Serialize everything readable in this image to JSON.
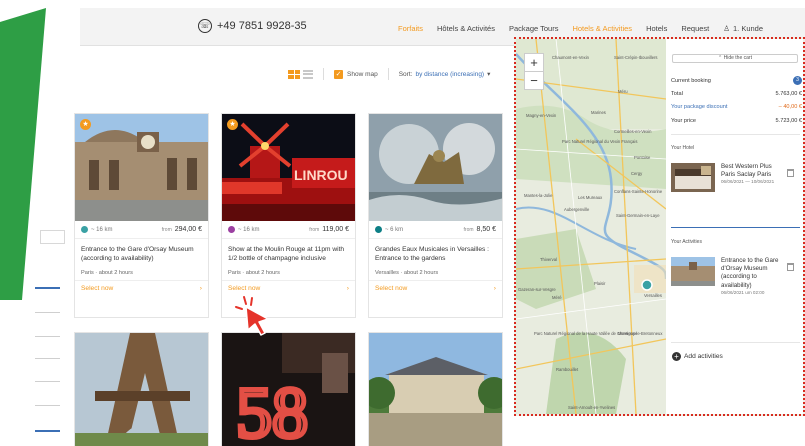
{
  "header": {
    "phone": "+49 7851 9928-35",
    "nav": [
      "Forfaits",
      "Hôtels & Activités",
      "Package Tours",
      "Hotels & Activities",
      "Hotels",
      "Request"
    ],
    "user": "1. Kunde"
  },
  "toolbar": {
    "show_map": "Show map",
    "sort_label": "Sort:",
    "sort_value": "by distance (increasing)"
  },
  "cards": [
    {
      "distance": "~ 16 km",
      "price_prefix": "from",
      "price": "294,00 €",
      "title": "Entrance to the Gare d'Orsay Museum (according to availability)",
      "location": "Paris · about 2 hours",
      "select": "Select now",
      "dot_color": "#3aa1a4"
    },
    {
      "distance": "~ 16 km",
      "price_prefix": "from",
      "price": "119,00 €",
      "title": "Show at the Moulin Rouge at 11pm with 1/2 bottle of champagne inclusive",
      "location": "Paris · about 2 hours",
      "select": "Select now",
      "dot_color": "#9b3fa1"
    },
    {
      "distance": "~ 6 km",
      "price_prefix": "from",
      "price": "8,50 €",
      "title": "Grandes Eaux Musicales in Versailles : Entrance to the gardens",
      "location": "Versailles · about 2 hours",
      "select": "Select now",
      "dot_color": "#0d7f86"
    }
  ],
  "map": {
    "zoom_in": "+",
    "zoom_out": "−",
    "labels": [
      "Chaumont-en-Vexin",
      "Saint-Crépin-Ibouvillers",
      "Méru",
      "Magny-en-Vexin",
      "Marines",
      "Parc Naturel Régional du Vexin Français",
      "Cormeilles-en-Vexin",
      "Pontoise",
      "Cergy",
      "Conflans-Sainte-Honorine",
      "Les Mureaux",
      "Mantes-la-Jolie",
      "Aubergenville",
      "Saint-Germain-en-Laye",
      "Thiverval",
      "Plaisir",
      "Versailles",
      "Gazeran-sur-Vesgre",
      "Méré",
      "Montigny-le-Bretonneux",
      "Parc Naturel Régional de la Haute Vallée de Chevreuse",
      "Rambouillet",
      "Saint-Arnoult-en-Yvelines"
    ]
  },
  "cart": {
    "hide": "Hide the cart",
    "current_booking": "Current booking",
    "count": "3",
    "total_label": "Total",
    "total": "5.763,00 €",
    "discount_label": "Your package discount",
    "discount": "– 40,00 €",
    "price_label": "Your price",
    "price": "5.723,00 €",
    "hotel_section": "Your Hotel",
    "hotel_name": "Best Western Plus Paris Saclay Paris",
    "hotel_dates": "06/06/2021 — 10/06/2021",
    "activities_section": "Your Activities",
    "activity_name": "Entrance to the Gare d'Orsay Museum (according to availability)",
    "activity_date": "06/06/2021 um 02:00",
    "add_activities": "Add activities"
  }
}
